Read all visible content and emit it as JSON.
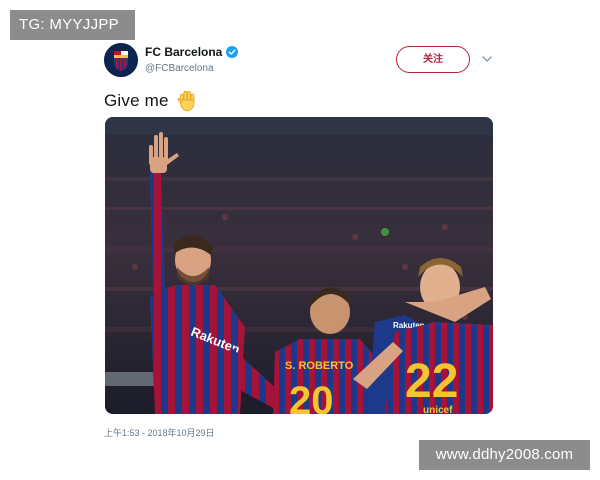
{
  "watermark_top_left": "TG: MYYJJPP",
  "watermark_bottom_right": "www.ddhy2008.com",
  "account": {
    "display_name": "FC Barcelona",
    "handle": "@FCBarcelona",
    "verified": true,
    "avatar_icon": "fc-barcelona-crest-icon"
  },
  "follow_label": "关注",
  "tweet": {
    "text": "Give me",
    "emoji": "raised-hand-emoji",
    "timestamp": "上午1:53 - 2018年10月29日"
  },
  "photo": {
    "jersey_name": "S. ROBERTO",
    "jersey_numbers": [
      "20",
      "22"
    ],
    "sponsor_text": "Rakuten",
    "colors": {
      "blaugrana_blue": "#1d3a8a",
      "blaugrana_red": "#a5123a",
      "yellow": "#f4c531"
    }
  },
  "colors": {
    "follow_accent": "#b3263f",
    "verified_blue": "#1da1f2",
    "watermark_bg": "#8c8c8c"
  }
}
